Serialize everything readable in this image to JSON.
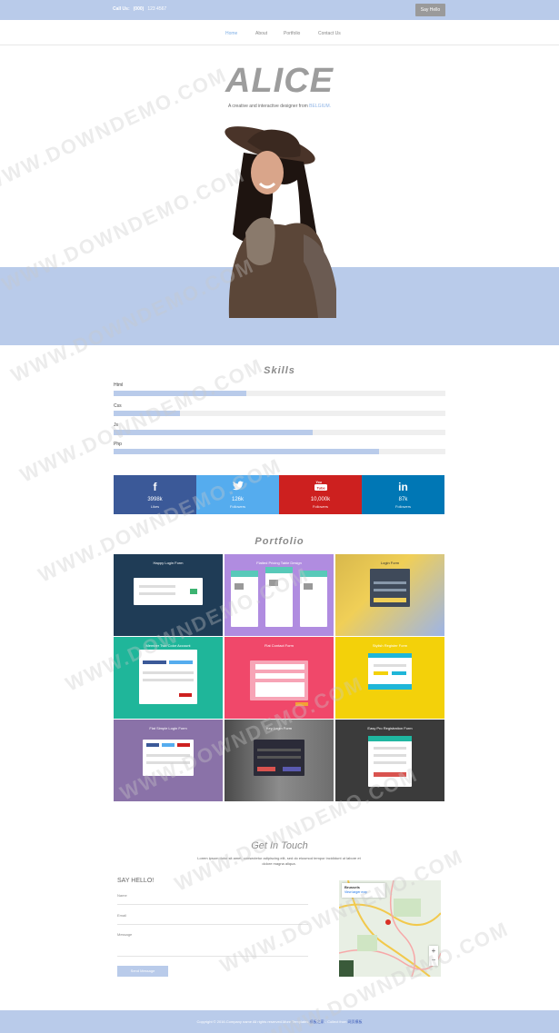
{
  "topbar": {
    "call_label": "Call Us:",
    "phone": "(000)",
    "phone_rest": "123 4567",
    "say_hello": "Say Hello"
  },
  "nav": {
    "items": [
      "Home",
      "About",
      "Portfolio",
      "Contact Us"
    ],
    "active": "Home"
  },
  "hero": {
    "name": "ALICE",
    "tagline": "A creative and interactive designer from",
    "city": "BELGIUM.",
    "photo_icon": "person-photo"
  },
  "skills": {
    "title": "Skills",
    "items": [
      {
        "label": "Html",
        "level": 0.4
      },
      {
        "label": "Css",
        "level": 0.2
      },
      {
        "label": "Js",
        "level": 0.6
      },
      {
        "label": "Php",
        "level": 0.8
      }
    ]
  },
  "social": [
    {
      "icon": "facebook-icon",
      "glyph": "f",
      "count": "3998k",
      "label": "Likes",
      "color": "#3b5998"
    },
    {
      "icon": "twitter-icon",
      "glyph": "🐦",
      "count": "126k",
      "label": "Followers",
      "color": "#55acee"
    },
    {
      "icon": "youtube-icon",
      "glyph": "▶",
      "count": "10,000k",
      "label": "Followers",
      "color": "#cd201f"
    },
    {
      "icon": "linkedin-icon",
      "glyph": "in",
      "count": "87k",
      "label": "Followers",
      "color": "#0077b5"
    }
  ],
  "portfolio": {
    "title": "Portfolio",
    "tiles": [
      {
        "title": "Happy Login Form",
        "bg": "#1f3c56"
      },
      {
        "title": "Flatted Pricing Table Design",
        "bg": "#b08ce0"
      },
      {
        "title": "Login Form",
        "bg": "#e9c93c"
      },
      {
        "title": "Member Two Color Account",
        "bg": "#1fb69a"
      },
      {
        "title": "Flat Contact Form",
        "bg": "#f0486a"
      },
      {
        "title": "Stylish Register Form",
        "bg": "#f3d10a"
      },
      {
        "title": "Flat Simple Login Form",
        "bg": "#8a72a8"
      },
      {
        "title": "Key Login Form",
        "bg": "#5e5e5e"
      },
      {
        "title": "Easy Pro Registration Form",
        "bg": "#3b3b3b"
      }
    ]
  },
  "contact": {
    "title": "Get In Touch",
    "text": "Lorem ipsum dolor sit amet, consectetur adipiscing elit, sed do eiusmod tempor incididunt ut labore et dolore magna aliqua.",
    "form_heading": "SAY HELLO!",
    "fields": [
      "Name",
      "Email",
      "Message"
    ],
    "send_label": "Send Message",
    "map_title": "Brussels",
    "map_link": "View larger map"
  },
  "footer": {
    "text": "Copyright © 2016.Company name All rights reserved.More Templates",
    "link1": "模板之家",
    "mid": "- Collect from",
    "link2": "网页模板"
  },
  "watermark": "WWW.DOWNDEMO.COM"
}
